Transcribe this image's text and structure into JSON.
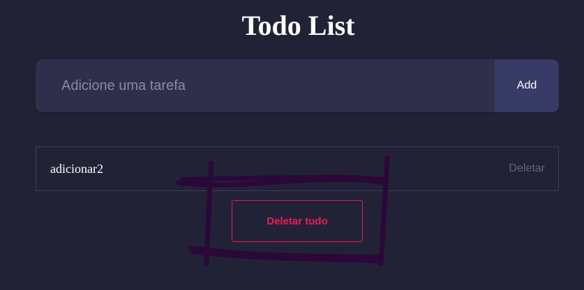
{
  "app": {
    "title": "Todo List"
  },
  "input": {
    "placeholder": "Adicione uma tarefa",
    "value": "",
    "add_label": "Add"
  },
  "tasks": [
    {
      "text": "adicionar2",
      "delete_label": "Deletar"
    }
  ],
  "actions": {
    "clear_all_label": "Deletar tudo"
  },
  "colors": {
    "background": "#222237",
    "input_background": "#2f2f4b",
    "add_button": "#393b67",
    "danger": "#ee1b55",
    "scribble": "#2a0838"
  }
}
